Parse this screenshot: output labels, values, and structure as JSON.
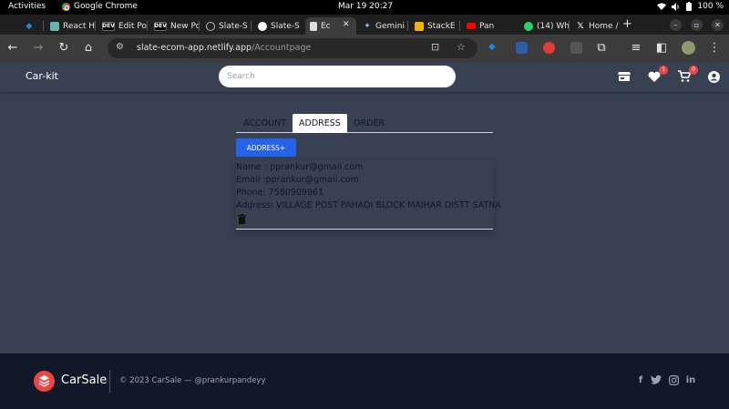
{
  "os_bar": {
    "activities": "Activities",
    "app_name": "Google Chrome",
    "datetime": "Mar 19  20:27",
    "battery": "100 %"
  },
  "browser": {
    "tabs": [
      {
        "label": "",
        "icon": "gem-icon",
        "color": "#1e88e5"
      },
      {
        "label": "React H",
        "icon": "react-icon",
        "color": "#64b5b0"
      },
      {
        "label": "Edit Po",
        "icon": "dev-icon",
        "color": "#000000"
      },
      {
        "label": "New Po",
        "icon": "dev-icon",
        "color": "#000000"
      },
      {
        "label": "Slate-S",
        "icon": "globe-icon",
        "color": "#9e9e9e"
      },
      {
        "label": "Slate-S",
        "icon": "github-icon",
        "color": "#ffffff"
      },
      {
        "label": "Ec",
        "icon": "page-icon",
        "color": "#e0e0e0"
      },
      {
        "label": "Gemini",
        "icon": "gemini-icon",
        "color": "#8ab4f8"
      },
      {
        "label": "StackE",
        "icon": "stackedit-icon",
        "color": "#f4b400"
      },
      {
        "label": "Pan",
        "icon": "youtube-icon",
        "color": "#ff0000"
      },
      {
        "label": "(14) Wh",
        "icon": "whatsapp-icon",
        "color": "#25d366"
      },
      {
        "label": "Home /",
        "icon": "x-icon",
        "color": "#000000"
      }
    ],
    "url_host": "slate-ecom-app.netlify.app",
    "url_path": "/Accountpage"
  },
  "site": {
    "brand": "Car-kit",
    "search_placeholder": "Search",
    "wishlist_count": "1",
    "cart_count": "0"
  },
  "account": {
    "tabs": [
      "ACCOUNT",
      "ADDRESS",
      "ORDER"
    ],
    "active_tab": "ADDRESS",
    "add_address_label": "ADDRESS+",
    "address": {
      "name": "Name : pprankur@gmail.com",
      "email": "Email :pprankur@gmail.com",
      "phone": "Phone: 7580909961",
      "address": "Address: VILLAGE POST PAHADI BLOCK MAIHAR DISTT SATNA"
    }
  },
  "footer": {
    "brand": "CarSale",
    "copyright": "© 2023 CarSale — @prankurpandeyy"
  },
  "colors": {
    "page_bg": "#374151",
    "footer_bg": "#111827",
    "accent_blue": "#2563eb",
    "badge_red": "#ef4444"
  }
}
